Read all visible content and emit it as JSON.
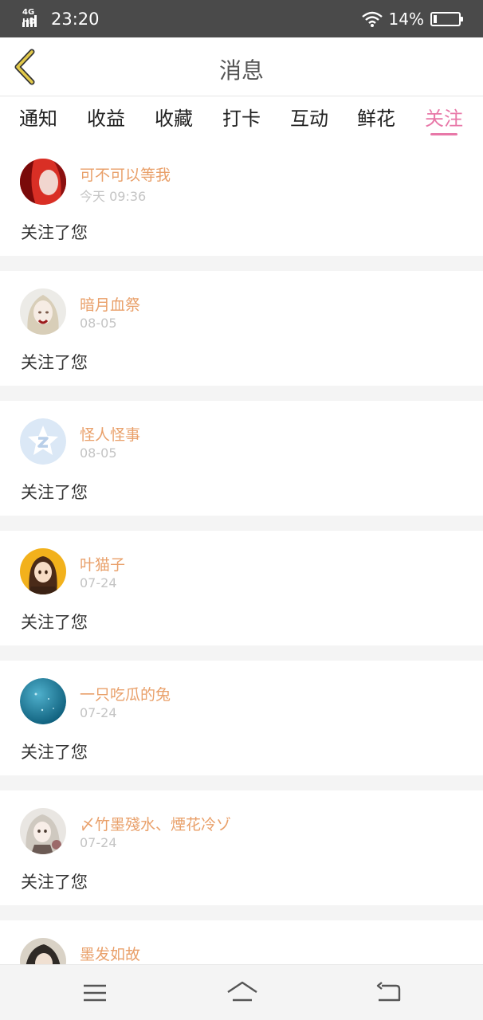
{
  "status_bar": {
    "network": "4G HD",
    "time": "23:20",
    "battery_text": "14%",
    "battery_level": 0.14
  },
  "header": {
    "title": "消息"
  },
  "tabs": [
    {
      "label": "通知",
      "active": false
    },
    {
      "label": "收益",
      "active": false
    },
    {
      "label": "收藏",
      "active": false
    },
    {
      "label": "打卡",
      "active": false
    },
    {
      "label": "互动",
      "active": false
    },
    {
      "label": "鲜花",
      "active": false
    },
    {
      "label": "关注",
      "active": true
    }
  ],
  "messages": [
    {
      "user": "可不可以等我",
      "time": "今天 09:36",
      "text": "关注了您"
    },
    {
      "user": "暗月血祭",
      "time": "08-05",
      "text": "关注了您"
    },
    {
      "user": "怪人怪事",
      "time": "08-05",
      "text": "关注了您"
    },
    {
      "user": "叶猫子",
      "time": "07-24",
      "text": "关注了您"
    },
    {
      "user": "一只吃瓜的兔",
      "time": "07-24",
      "text": "关注了您"
    },
    {
      "user": "〆竹墨殘水、煙花冷ゾ",
      "time": "07-24",
      "text": "关注了您"
    },
    {
      "user": "墨发如故",
      "time": "",
      "text": ""
    }
  ],
  "colors": {
    "accent": "#e878a8",
    "username": "#e9a06a",
    "back_arrow": "#e2c94a"
  },
  "icons": {
    "back": "chevron-left-icon",
    "wifi": "wifi-icon",
    "battery": "battery-icon",
    "menu": "menu-icon",
    "home": "home-icon",
    "return": "return-icon"
  }
}
